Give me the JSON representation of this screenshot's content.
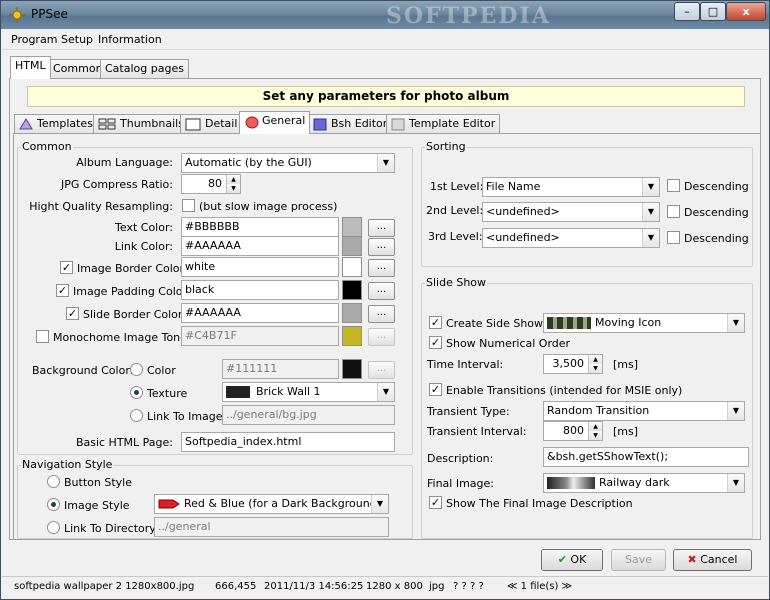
{
  "window": {
    "title": "PPSee",
    "watermark": "SOFTPEDIA",
    "minimize": "–",
    "maximize": "□",
    "close": "x"
  },
  "menu": [
    "Program",
    "Setup",
    "Information"
  ],
  "top_tabs": [
    "HTML",
    "Common",
    "Catalog pages"
  ],
  "banner": "Set any parameters for photo album",
  "sub_tabs": [
    "Templates",
    "Thumbnails",
    "Detail",
    "General",
    "Bsh Editor",
    "Template Editor"
  ],
  "common": {
    "title": "Common",
    "album_language_label": "Album Language:",
    "album_language": "Automatic (by the GUI)",
    "jpg_ratio_label": "JPG Compress Ratio:",
    "jpg_ratio": "80",
    "hq_label": "Hight Quality Resampling:",
    "hq_note": "(but slow image process)",
    "text_color_label": "Text Color:",
    "text_color": "#BBBBBB",
    "link_color_label": "Link Color:",
    "link_color": "#AAAAAA",
    "border_color_label": "Image Border Color:",
    "border_color": "white",
    "padding_color_label": "Image Padding Color:",
    "padding_color": "black",
    "slide_border_label": "Slide Border Color:",
    "slide_border": "#AAAAAA",
    "mono_label": "Monochome Image Tone:",
    "mono": "#C4B71F",
    "bg_label": "Background Color:",
    "bg_color_label": "Color",
    "bg_color": "#111111",
    "texture_label": "Texture",
    "texture": "Brick Wall 1",
    "link_image_label": "Link To Image",
    "link_image": "../general/bg.jpg",
    "basic_page_label": "Basic HTML Page:",
    "basic_page": "Softpedia_index.html",
    "dots": "...",
    "colors": {
      "text": "#bbbbbb",
      "link": "#aaaaaa",
      "border": "#ffffff",
      "padding": "#000000",
      "slide": "#aaaaaa",
      "mono": "#c4b71f",
      "bg": "#111111"
    }
  },
  "navigation": {
    "title": "Navigation Style",
    "button_style": "Button Style",
    "image_style": "Image Style",
    "image_style_value": "Red & Blue (for a Dark Background)",
    "link_dir": "Link To Directory",
    "link_dir_value": "../general"
  },
  "sorting": {
    "title": "Sorting",
    "levels": [
      {
        "label": "1st Level:",
        "value": "File Name",
        "desc": "Descending"
      },
      {
        "label": "2nd Level:",
        "value": "<undefined>",
        "desc": "Descending"
      },
      {
        "label": "3rd Level:",
        "value": "<undefined>",
        "desc": "Descending"
      }
    ]
  },
  "slideshow": {
    "title": "Slide Show",
    "create": "Create Side Show",
    "create_value": "Moving Icon",
    "numerical": "Show Numerical Order",
    "interval_label": "Time Interval:",
    "interval": "3,500",
    "ms": "[ms]",
    "transitions": "Enable Transitions (intended for MSIE only)",
    "trans_type_label": "Transient Type:",
    "trans_type": "Random Transition",
    "trans_interval_label": "Transient Interval:",
    "trans_interval": "800",
    "desc_label": "Description:",
    "desc": "&bsh.getSShowText();",
    "final_label": "Final Image:",
    "final": "Railway dark",
    "final_desc": "Show The Final Image Description"
  },
  "buttons": {
    "ok": "OK",
    "save": "Save",
    "cancel": "Cancel"
  },
  "status": {
    "file": "softpedia  wallpaper  2  1280x800.jpg",
    "size": "666,455",
    "date": "2011/11/3 14:56:25",
    "dims": "1280 x 800",
    "ext": "jpg",
    "q": "?  ?  ?  ?",
    "count": "≪ 1 file(s) ≫"
  }
}
